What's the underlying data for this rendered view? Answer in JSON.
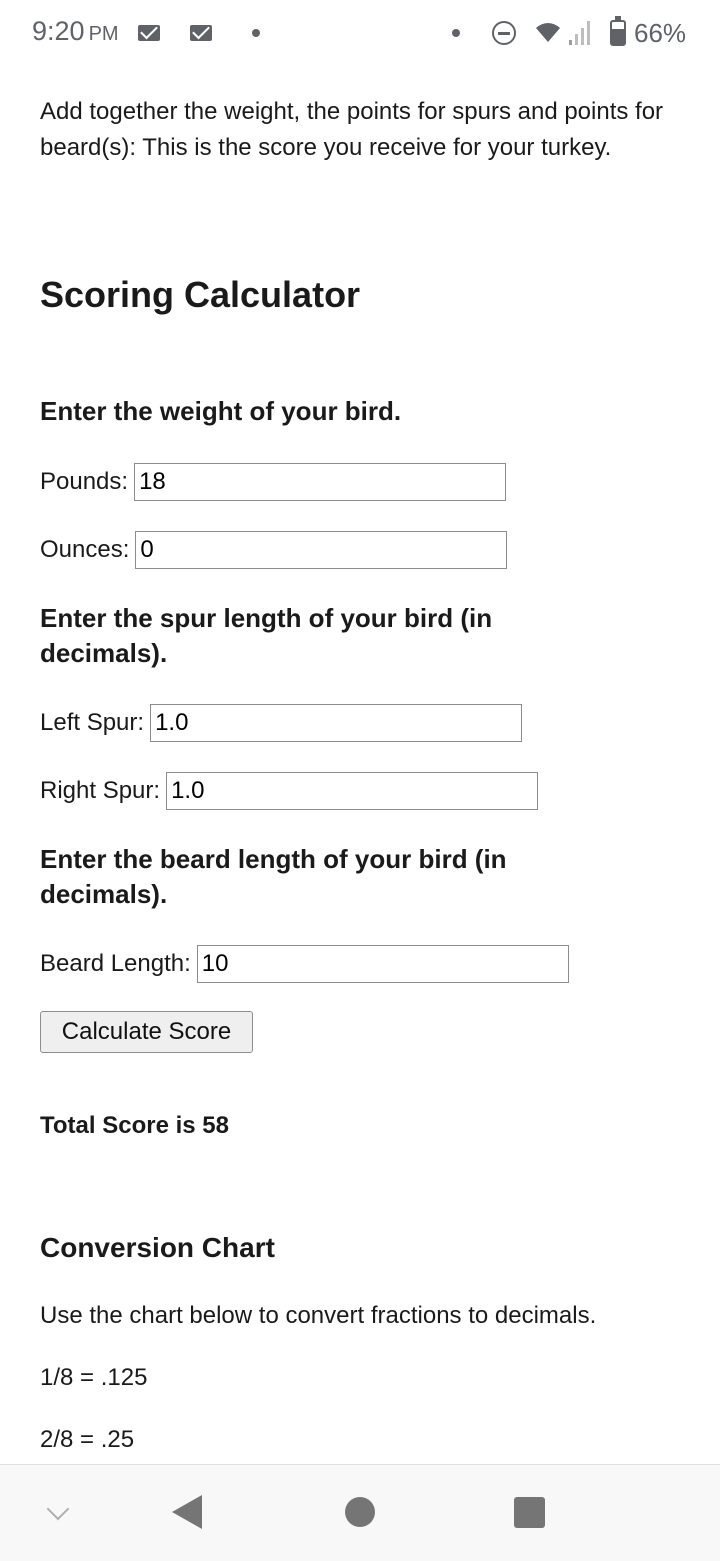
{
  "status_bar": {
    "time": "9:20",
    "ampm": "PM",
    "battery": "66%",
    "battery_level": 0.66,
    "icons": [
      "mail-icon",
      "mail-icon",
      "notification-dot-icon",
      "notification-dot-icon",
      "do-not-disturb-icon",
      "wifi-icon",
      "signal-icon",
      "battery-icon"
    ]
  },
  "intro_text": "Add together the weight, the points for spurs and points for beard(s): This is the score you receive for your turkey.",
  "calculator": {
    "title": "Scoring Calculator",
    "weight_heading": "Enter the weight of your bird.",
    "pounds_label": "Pounds:",
    "pounds_value": "18",
    "ounces_label": "Ounces:",
    "ounces_value": "0",
    "spur_heading": "Enter the spur length of your bird (in decimals).",
    "left_spur_label": "Left Spur:",
    "left_spur_value": "1.0",
    "right_spur_label": "Right Spur:",
    "right_spur_value": "1.0",
    "beard_heading": "Enter the beard length of your bird (in decimals).",
    "beard_label": "Beard Length:",
    "beard_value": "10",
    "button_label": "Calculate Score",
    "total_text": "Total Score is 58"
  },
  "conversion": {
    "title": "Conversion Chart",
    "description": "Use the chart below to convert fractions to decimals.",
    "items": [
      "1/8 = .125",
      "2/8 = .25"
    ]
  },
  "nav_bar": {
    "icons": [
      "chevron-down-icon",
      "back-icon",
      "home-icon",
      "recents-icon"
    ]
  }
}
